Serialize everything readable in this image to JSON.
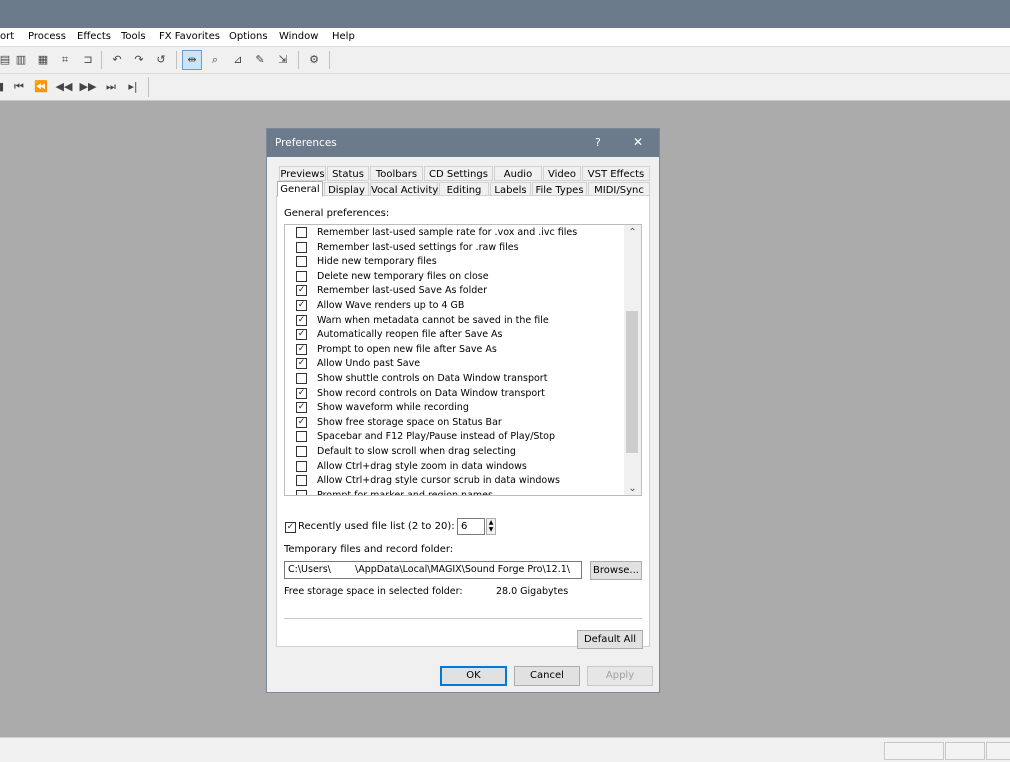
{
  "menu": [
    "ort",
    "Process",
    "Effects",
    "Tools",
    "FX Favorites",
    "Options",
    "Window",
    "Help"
  ],
  "toolbar_icons": [
    "paste-icon",
    "paste-new-icon",
    "mix-icon",
    "crop-icon",
    "undo-icon",
    "redo-icon",
    "repeat-icon",
    "edit-tool-icon",
    "magnify-tool-icon",
    "envelope-tool-icon",
    "pencil-tool-icon",
    "event-tool-icon",
    "plugin-chain-icon"
  ],
  "transport_icons": [
    "stop-icon",
    "go-to-start-icon",
    "rewind-icon",
    "fast-forward-icon",
    "go-to-end-icon",
    "next-icon"
  ],
  "dialog": {
    "title": "Preferences",
    "help": "?",
    "close": "✕",
    "tabs_row1": [
      "Previews",
      "Status",
      "Toolbars",
      "CD Settings",
      "Audio",
      "Video",
      "VST Effects"
    ],
    "tabs_row2": [
      "General",
      "Display",
      "Vocal Activity",
      "Editing",
      "Labels",
      "File Types",
      "MIDI/Sync"
    ],
    "section_label": "General preferences:",
    "items": [
      {
        "label": "Remember last-used sample rate for .vox and .ivc files",
        "checked": false
      },
      {
        "label": "Remember last-used settings for .raw files",
        "checked": false
      },
      {
        "label": "Hide new temporary files",
        "checked": false
      },
      {
        "label": "Delete new temporary files on close",
        "checked": false
      },
      {
        "label": "Remember last-used Save As folder",
        "checked": true
      },
      {
        "label": "Allow Wave renders up to 4 GB",
        "checked": true
      },
      {
        "label": "Warn when metadata cannot be saved in the file",
        "checked": true
      },
      {
        "label": "Automatically reopen file after Save As",
        "checked": true
      },
      {
        "label": "Prompt to open new file after Save As",
        "checked": true
      },
      {
        "label": "Allow Undo past Save",
        "checked": true
      },
      {
        "label": "Show shuttle controls on Data Window transport",
        "checked": false
      },
      {
        "label": "Show record controls on Data Window transport",
        "checked": true
      },
      {
        "label": "Show waveform while recording",
        "checked": true
      },
      {
        "label": "Show free storage space on Status Bar",
        "checked": true
      },
      {
        "label": "Spacebar and F12 Play/Pause instead of Play/Stop",
        "checked": false
      },
      {
        "label": "Default to slow scroll when drag selecting",
        "checked": false
      },
      {
        "label": "Allow Ctrl+drag style zoom in data windows",
        "checked": false
      },
      {
        "label": "Allow Ctrl+drag style cursor scrub in data windows",
        "checked": false
      },
      {
        "label": "Prompt for marker and region names",
        "checked": false
      }
    ],
    "recent_label": "Recently used file list (2 to 20):",
    "recent_checked": true,
    "recent_value": "6",
    "temp_label": "Temporary files and record folder:",
    "temp_path": "C:\\Users\\        \\AppData\\Local\\MAGIX\\Sound Forge Pro\\12.1\\",
    "browse": "Browse...",
    "free_label": "Free storage space in selected folder:",
    "free_value": "28.0 Gigabytes",
    "default_all": "Default All",
    "ok": "OK",
    "cancel": "Cancel",
    "apply": "Apply"
  }
}
